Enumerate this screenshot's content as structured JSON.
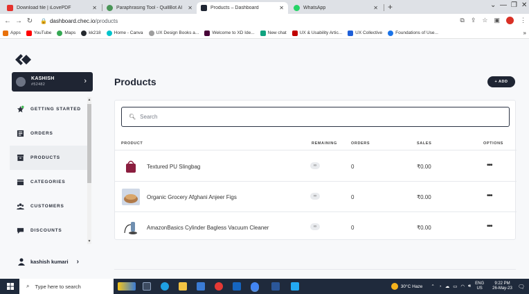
{
  "browser": {
    "tabs": [
      {
        "title": "Download file | iLovePDF",
        "color": "#e5322d"
      },
      {
        "title": "Paraphrasing Tool - QuillBot AI",
        "color": "#499557"
      },
      {
        "title": "Products – Dashboard",
        "color": "#1f2533"
      },
      {
        "title": "WhatsApp",
        "color": "#25d366"
      }
    ],
    "new_tab": "+",
    "url_host": "dashboard.chec.io",
    "url_path": "/products",
    "bookmarks": [
      {
        "label": "Apps",
        "color": "#e8710a"
      },
      {
        "label": "YouTube",
        "color": "#ff0000"
      },
      {
        "label": "Maps",
        "color": "#34a853"
      },
      {
        "label": "kk218",
        "color": "#24292e"
      },
      {
        "label": "Home - Canva",
        "color": "#00c4cc"
      },
      {
        "label": "UX Design Books a...",
        "color": "#9e9e9e"
      },
      {
        "label": "Welcome to XD Ide...",
        "color": "#470137"
      },
      {
        "label": "New chat",
        "color": "#10a37f"
      },
      {
        "label": "UX & Usability Artic...",
        "color": "#c00000"
      },
      {
        "label": "UX Collective",
        "color": "#1e5fd8"
      },
      {
        "label": "Foundations of Use...",
        "color": "#1a73e8"
      }
    ],
    "bookmarks_more": "»"
  },
  "sidebar": {
    "user": {
      "name": "KASHISH",
      "id": "#52482"
    },
    "items": [
      {
        "label": "GETTING STARTED",
        "icon": "star-icon"
      },
      {
        "label": "ORDERS",
        "icon": "orders-icon"
      },
      {
        "label": "PRODUCTS",
        "icon": "products-icon"
      },
      {
        "label": "CATEGORIES",
        "icon": "categories-icon"
      },
      {
        "label": "CUSTOMERS",
        "icon": "customers-icon"
      },
      {
        "label": "DISCOUNTS",
        "icon": "discounts-icon"
      }
    ],
    "active_item": "PRODUCTS",
    "bottom_user": "kashish kumari"
  },
  "main": {
    "title": "Products",
    "add_label": "+ ADD",
    "search_placeholder": "Search",
    "columns": [
      "PRODUCT",
      "REMAINING",
      "ORDERS",
      "SALES",
      "OPTIONS"
    ],
    "rows": [
      {
        "name": "Textured PU Slingbag",
        "remaining": "∞",
        "orders": "0",
        "sales": "₹0.00",
        "options": "•••",
        "thumb_color": "#8b1e3f"
      },
      {
        "name": "Organic Grocery Afghani Anjeer Figs",
        "remaining": "∞",
        "orders": "0",
        "sales": "₹0.00",
        "options": "•••",
        "thumb_color": "#b07a4a"
      },
      {
        "name": "AmazonBasics Cylinder Bagless Vacuum Cleaner",
        "remaining": "∞",
        "orders": "0",
        "sales": "₹0.00",
        "options": "•••",
        "thumb_color": "#6f8fb0"
      }
    ]
  },
  "taskbar": {
    "search_placeholder": "Type here to search",
    "weather": "30°C Haze",
    "language": "ENG",
    "region": "US",
    "time": "9:22 PM",
    "date": "26-May-23"
  }
}
